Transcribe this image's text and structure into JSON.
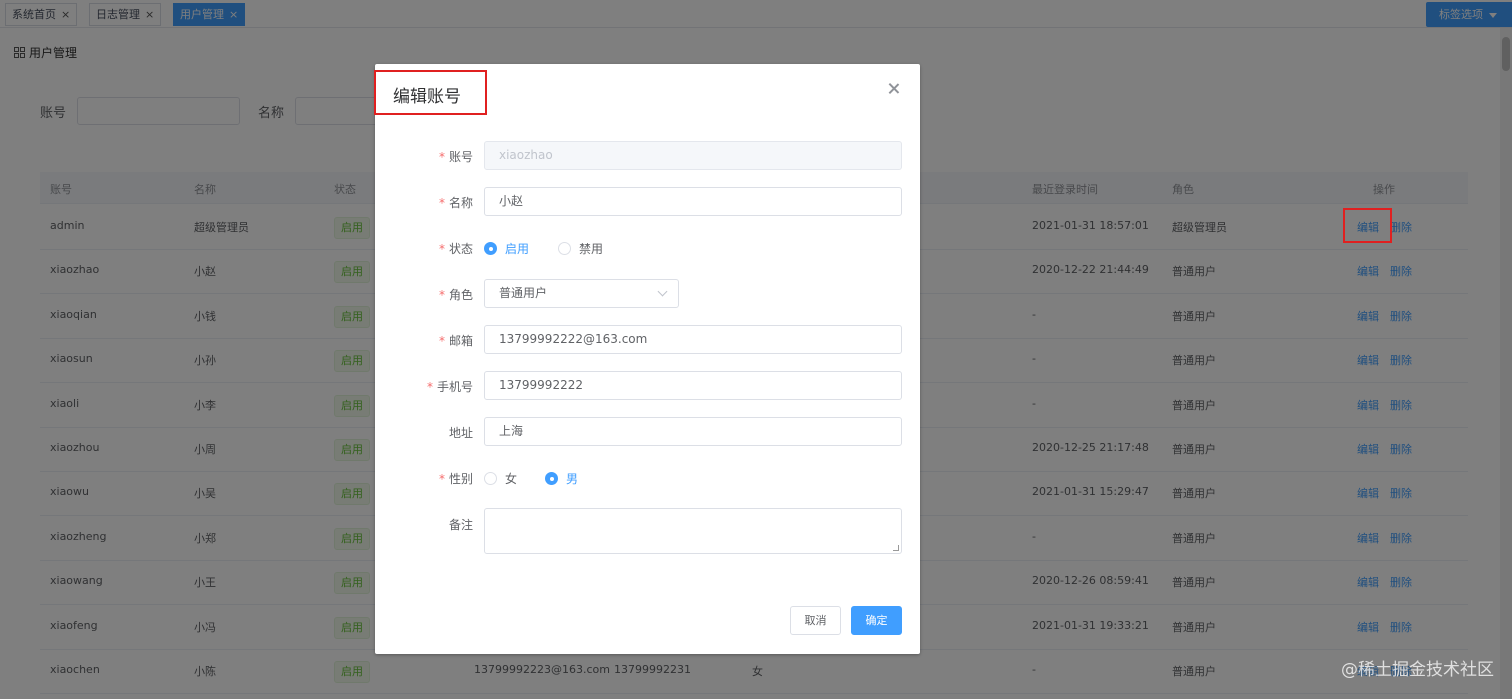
{
  "tabs": [
    {
      "label": "系统首页",
      "close": "×",
      "active": false
    },
    {
      "label": "日志管理",
      "close": "×",
      "active": false
    },
    {
      "label": "用户管理",
      "close": "×",
      "active": true
    }
  ],
  "tab_options_label": "标签选项",
  "page_title": "用户管理",
  "search": {
    "account_label": "账号",
    "name_label": "名称"
  },
  "table": {
    "headers": {
      "account": "账号",
      "name": "名称",
      "status": "状态",
      "last_login": "最近登录时间",
      "role": "角色",
      "actions": "操作"
    },
    "rows": [
      {
        "account": "admin",
        "name": "超级管理员",
        "status": "启用",
        "last_login": "2021-01-31 18:57:01",
        "role": "超级管理员",
        "edit": "编辑",
        "delete": "删除"
      },
      {
        "account": "xiaozhao",
        "name": "小赵",
        "status": "启用",
        "last_login": "2020-12-22 21:44:49",
        "role": "普通用户",
        "edit": "编辑",
        "delete": "删除"
      },
      {
        "account": "xiaoqian",
        "name": "小钱",
        "status": "启用",
        "last_login": "-",
        "role": "普通用户",
        "edit": "编辑",
        "delete": "删除"
      },
      {
        "account": "xiaosun",
        "name": "小孙",
        "status": "启用",
        "last_login": "-",
        "role": "普通用户",
        "edit": "编辑",
        "delete": "删除"
      },
      {
        "account": "xiaoli",
        "name": "小李",
        "status": "启用",
        "last_login": "-",
        "role": "普通用户",
        "edit": "编辑",
        "delete": "删除"
      },
      {
        "account": "xiaozhou",
        "name": "小周",
        "status": "启用",
        "last_login": "2020-12-25 21:17:48",
        "role": "普通用户",
        "edit": "编辑",
        "delete": "删除"
      },
      {
        "account": "xiaowu",
        "name": "小吴",
        "status": "启用",
        "last_login": "2021-01-31 15:29:47",
        "role": "普通用户",
        "edit": "编辑",
        "delete": "删除"
      },
      {
        "account": "xiaozheng",
        "name": "小郑",
        "status": "启用",
        "last_login": "-",
        "role": "普通用户",
        "edit": "编辑",
        "delete": "删除"
      },
      {
        "account": "xiaowang",
        "name": "小王",
        "status": "启用",
        "last_login": "2020-12-26 08:59:41",
        "role": "普通用户",
        "edit": "编辑",
        "delete": "删除"
      },
      {
        "account": "xiaofeng",
        "name": "小冯",
        "status": "启用",
        "last_login": "2021-01-31 19:33:21",
        "role": "普通用户",
        "edit": "编辑",
        "delete": "删除"
      },
      {
        "account": "xiaochen",
        "name": "小陈",
        "status": "启用",
        "email": "13799992223@163.com",
        "phone": "13799992231",
        "gender": "女",
        "last_login": "-",
        "role": "普通用户",
        "edit": "编辑",
        "delete": "删除"
      }
    ]
  },
  "dialog": {
    "title": "编辑账号",
    "close_icon": "close-icon",
    "fields": {
      "account": {
        "label": "账号",
        "required": "*",
        "value": "xiaozhao"
      },
      "name": {
        "label": "名称",
        "required": "*",
        "value": "小赵"
      },
      "status": {
        "label": "状态",
        "required": "*",
        "options": [
          "启用",
          "禁用"
        ],
        "selected": "启用"
      },
      "role": {
        "label": "角色",
        "required": "*",
        "value": "普通用户"
      },
      "email": {
        "label": "邮箱",
        "required": "*",
        "value": "13799992222@163.com"
      },
      "phone": {
        "label": "手机号",
        "required": "*",
        "value": "13799992222"
      },
      "address": {
        "label": "地址",
        "value": "上海"
      },
      "gender": {
        "label": "性别",
        "required": "*",
        "options": [
          "女",
          "男"
        ],
        "selected": "男"
      },
      "remark": {
        "label": "备注",
        "value": ""
      }
    },
    "cancel_label": "取消",
    "confirm_label": "确定"
  },
  "watermark": "@稀土掘金技术社区",
  "colors": {
    "primary": "#409eff",
    "success": "#67c23a",
    "required": "#f56c6c",
    "highlight": "#e02020"
  }
}
